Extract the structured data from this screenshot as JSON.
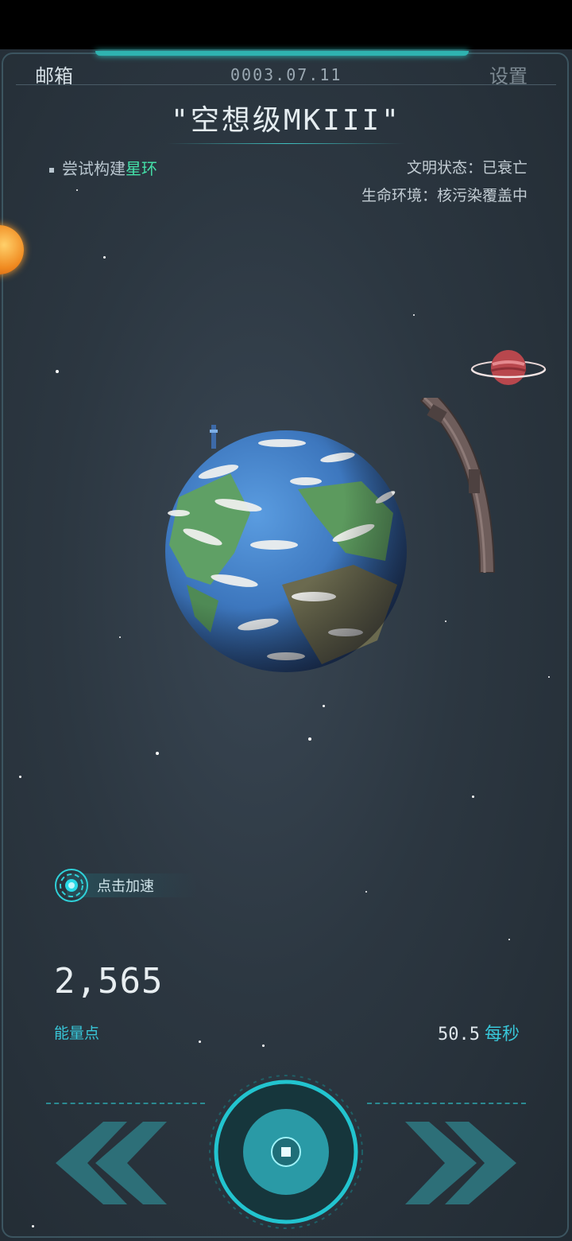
{
  "header": {
    "mail_label": "邮箱",
    "date": "0003.07.11",
    "settings_label": "设置"
  },
  "planet": {
    "name": "\"空想级MKIII\""
  },
  "task": {
    "prefix": "尝试构建",
    "highlight": "星环"
  },
  "status": {
    "civilization": "文明状态：已衰亡",
    "environment": "生命环境：核污染覆盖中"
  },
  "boost": {
    "label": "点击加速"
  },
  "energy": {
    "value": "2,565",
    "label": "能量点",
    "rate_value": "50.5",
    "rate_unit": "每秒"
  },
  "colors": {
    "accent": "#2fb3b0",
    "highlight_green": "#44e0a8",
    "label_cyan": "#38c6d8"
  },
  "icons": {
    "boost": "boost-target-icon",
    "prev": "double-chevron-left-icon",
    "next": "double-chevron-right-icon",
    "center": "center-action-icon"
  }
}
